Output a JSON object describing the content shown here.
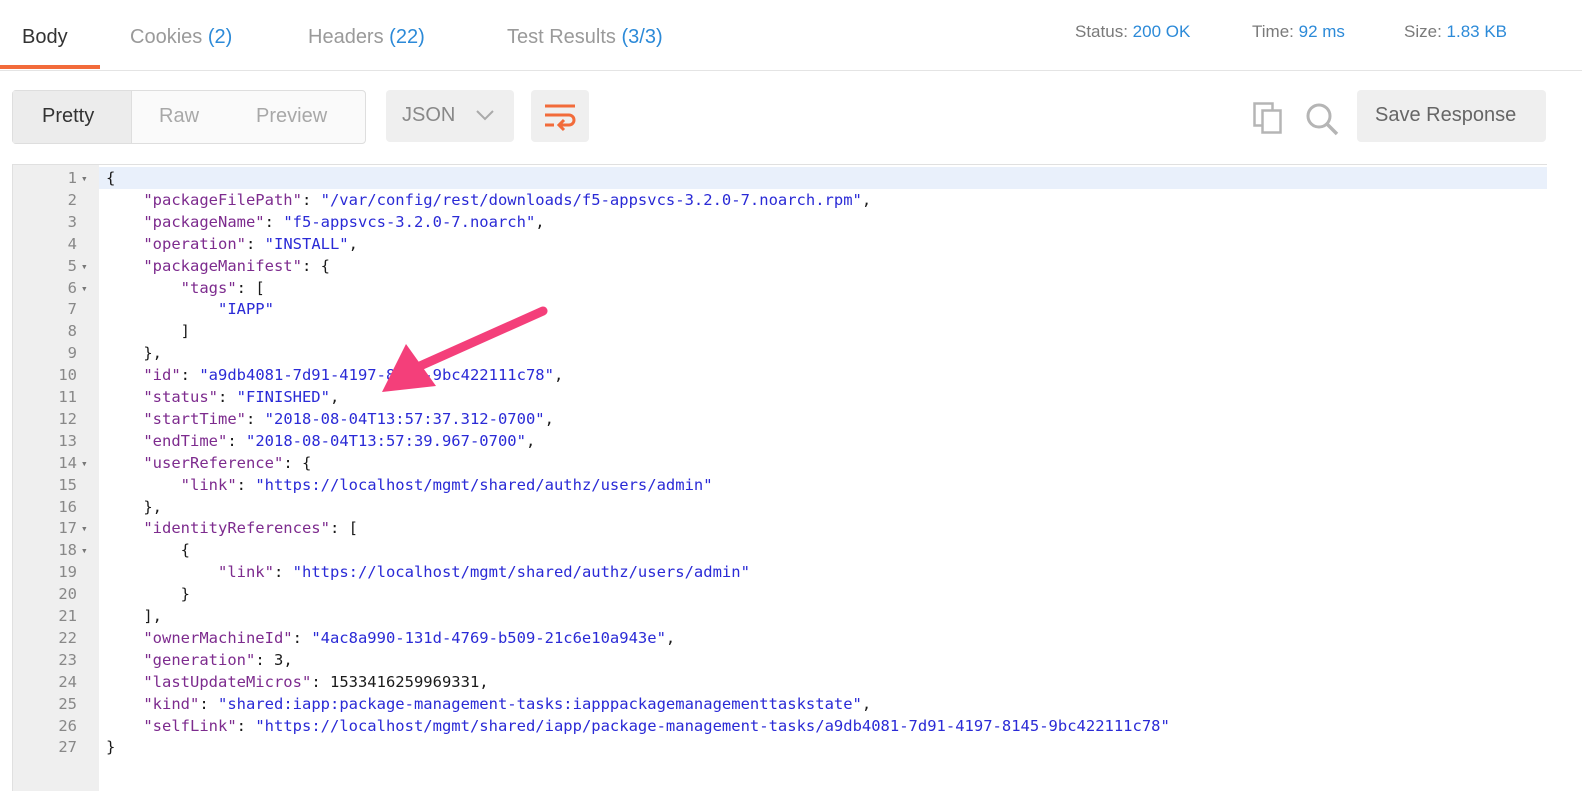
{
  "tabs": [
    {
      "label": "Body",
      "count": ""
    },
    {
      "label": "Cookies",
      "count": "(2)"
    },
    {
      "label": "Headers",
      "count": "(22)"
    },
    {
      "label": "Test Results",
      "count": "(3/3)"
    }
  ],
  "meta": {
    "status_label": "Status:",
    "status_value": "200 OK",
    "time_label": "Time:",
    "time_value": "92 ms",
    "size_label": "Size:",
    "size_value": "1.83 KB"
  },
  "toolbar": {
    "pretty": "Pretty",
    "raw": "Raw",
    "preview": "Preview",
    "format": "JSON",
    "save": "Save Response"
  },
  "icons": [
    "wrap-lines-icon",
    "copy-icon",
    "search-icon",
    "chevron-down-icon",
    "annotation-arrow"
  ],
  "colors": {
    "accent": "#f26b3a",
    "link": "#2c8ad8",
    "arrow": "#f43f7a"
  },
  "code_lines": [
    [
      {
        "t": "{",
        "c": "p"
      }
    ],
    [
      {
        "t": "    ",
        "c": "p"
      },
      {
        "t": "\"packageFilePath\"",
        "c": "k"
      },
      {
        "t": ": ",
        "c": "p"
      },
      {
        "t": "\"/var/config/rest/downloads/f5-appsvcs-3.2.0-7.noarch.rpm\"",
        "c": "s"
      },
      {
        "t": ",",
        "c": "p"
      }
    ],
    [
      {
        "t": "    ",
        "c": "p"
      },
      {
        "t": "\"packageName\"",
        "c": "k"
      },
      {
        "t": ": ",
        "c": "p"
      },
      {
        "t": "\"f5-appsvcs-3.2.0-7.noarch\"",
        "c": "s"
      },
      {
        "t": ",",
        "c": "p"
      }
    ],
    [
      {
        "t": "    ",
        "c": "p"
      },
      {
        "t": "\"operation\"",
        "c": "k"
      },
      {
        "t": ": ",
        "c": "p"
      },
      {
        "t": "\"INSTALL\"",
        "c": "s"
      },
      {
        "t": ",",
        "c": "p"
      }
    ],
    [
      {
        "t": "    ",
        "c": "p"
      },
      {
        "t": "\"packageManifest\"",
        "c": "k"
      },
      {
        "t": ": {",
        "c": "p"
      }
    ],
    [
      {
        "t": "        ",
        "c": "p"
      },
      {
        "t": "\"tags\"",
        "c": "k"
      },
      {
        "t": ": [",
        "c": "p"
      }
    ],
    [
      {
        "t": "            ",
        "c": "p"
      },
      {
        "t": "\"IAPP\"",
        "c": "s"
      }
    ],
    [
      {
        "t": "        ]",
        "c": "p"
      }
    ],
    [
      {
        "t": "    },",
        "c": "p"
      }
    ],
    [
      {
        "t": "    ",
        "c": "p"
      },
      {
        "t": "\"id\"",
        "c": "k"
      },
      {
        "t": ": ",
        "c": "p"
      },
      {
        "t": "\"a9db4081-7d91-4197-8145-9bc422111c78\"",
        "c": "s"
      },
      {
        "t": ",",
        "c": "p"
      }
    ],
    [
      {
        "t": "    ",
        "c": "p"
      },
      {
        "t": "\"status\"",
        "c": "k"
      },
      {
        "t": ": ",
        "c": "p"
      },
      {
        "t": "\"FINISHED\"",
        "c": "s"
      },
      {
        "t": ",",
        "c": "p"
      }
    ],
    [
      {
        "t": "    ",
        "c": "p"
      },
      {
        "t": "\"startTime\"",
        "c": "k"
      },
      {
        "t": ": ",
        "c": "p"
      },
      {
        "t": "\"2018-08-04T13:57:37.312-0700\"",
        "c": "s"
      },
      {
        "t": ",",
        "c": "p"
      }
    ],
    [
      {
        "t": "    ",
        "c": "p"
      },
      {
        "t": "\"endTime\"",
        "c": "k"
      },
      {
        "t": ": ",
        "c": "p"
      },
      {
        "t": "\"2018-08-04T13:57:39.967-0700\"",
        "c": "s"
      },
      {
        "t": ",",
        "c": "p"
      }
    ],
    [
      {
        "t": "    ",
        "c": "p"
      },
      {
        "t": "\"userReference\"",
        "c": "k"
      },
      {
        "t": ": {",
        "c": "p"
      }
    ],
    [
      {
        "t": "        ",
        "c": "p"
      },
      {
        "t": "\"link\"",
        "c": "k"
      },
      {
        "t": ": ",
        "c": "p"
      },
      {
        "t": "\"https://localhost/mgmt/shared/authz/users/admin\"",
        "c": "s"
      }
    ],
    [
      {
        "t": "    },",
        "c": "p"
      }
    ],
    [
      {
        "t": "    ",
        "c": "p"
      },
      {
        "t": "\"identityReferences\"",
        "c": "k"
      },
      {
        "t": ": [",
        "c": "p"
      }
    ],
    [
      {
        "t": "        {",
        "c": "p"
      }
    ],
    [
      {
        "t": "            ",
        "c": "p"
      },
      {
        "t": "\"link\"",
        "c": "k"
      },
      {
        "t": ": ",
        "c": "p"
      },
      {
        "t": "\"https://localhost/mgmt/shared/authz/users/admin\"",
        "c": "s"
      }
    ],
    [
      {
        "t": "        }",
        "c": "p"
      }
    ],
    [
      {
        "t": "    ],",
        "c": "p"
      }
    ],
    [
      {
        "t": "    ",
        "c": "p"
      },
      {
        "t": "\"ownerMachineId\"",
        "c": "k"
      },
      {
        "t": ": ",
        "c": "p"
      },
      {
        "t": "\"4ac8a990-131d-4769-b509-21c6e10a943e\"",
        "c": "s"
      },
      {
        "t": ",",
        "c": "p"
      }
    ],
    [
      {
        "t": "    ",
        "c": "p"
      },
      {
        "t": "\"generation\"",
        "c": "k"
      },
      {
        "t": ": ",
        "c": "p"
      },
      {
        "t": "3",
        "c": "n"
      },
      {
        "t": ",",
        "c": "p"
      }
    ],
    [
      {
        "t": "    ",
        "c": "p"
      },
      {
        "t": "\"lastUpdateMicros\"",
        "c": "k"
      },
      {
        "t": ": ",
        "c": "p"
      },
      {
        "t": "1533416259969331",
        "c": "n"
      },
      {
        "t": ",",
        "c": "p"
      }
    ],
    [
      {
        "t": "    ",
        "c": "p"
      },
      {
        "t": "\"kind\"",
        "c": "k"
      },
      {
        "t": ": ",
        "c": "p"
      },
      {
        "t": "\"shared:iapp:package-management-tasks:iapppackagemanagementtaskstate\"",
        "c": "s"
      },
      {
        "t": ",",
        "c": "p"
      }
    ],
    [
      {
        "t": "    ",
        "c": "p"
      },
      {
        "t": "\"selfLink\"",
        "c": "k"
      },
      {
        "t": ": ",
        "c": "p"
      },
      {
        "t": "\"https://localhost/mgmt/shared/iapp/package-management-tasks/a9db4081-7d91-4197-8145-9bc422111c78\"",
        "c": "s"
      }
    ],
    [
      {
        "t": "}",
        "c": "p"
      }
    ]
  ],
  "fold_lines": [
    1,
    5,
    6,
    14,
    17,
    18
  ]
}
